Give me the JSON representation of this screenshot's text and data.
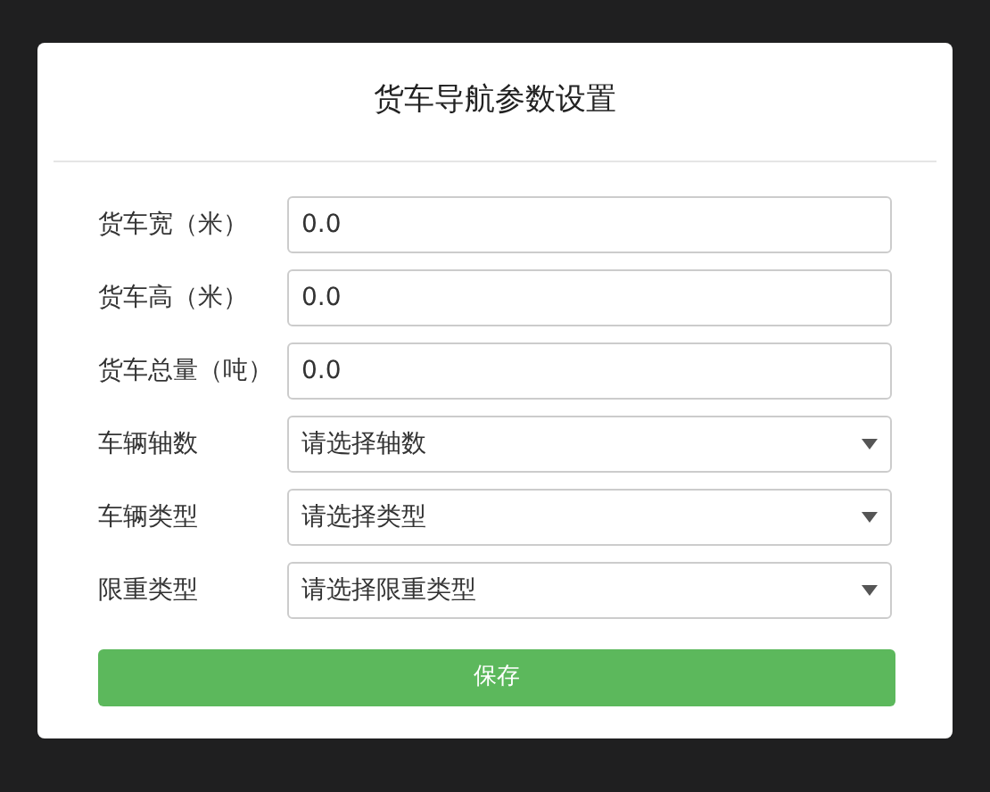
{
  "dialog": {
    "title": "货车导航参数设置",
    "fields": [
      {
        "kind": "text",
        "label": "货车宽（米）",
        "value": "0.0"
      },
      {
        "kind": "text",
        "label": "货车高（米）",
        "value": "0.0"
      },
      {
        "kind": "text",
        "label": "货车总量（吨）",
        "value": "0.0"
      },
      {
        "kind": "select",
        "label": "车辆轴数",
        "value": "请选择轴数"
      },
      {
        "kind": "select",
        "label": "车辆类型",
        "value": "请选择类型"
      },
      {
        "kind": "select",
        "label": "限重类型",
        "value": "请选择限重类型"
      }
    ],
    "button": "保存"
  }
}
